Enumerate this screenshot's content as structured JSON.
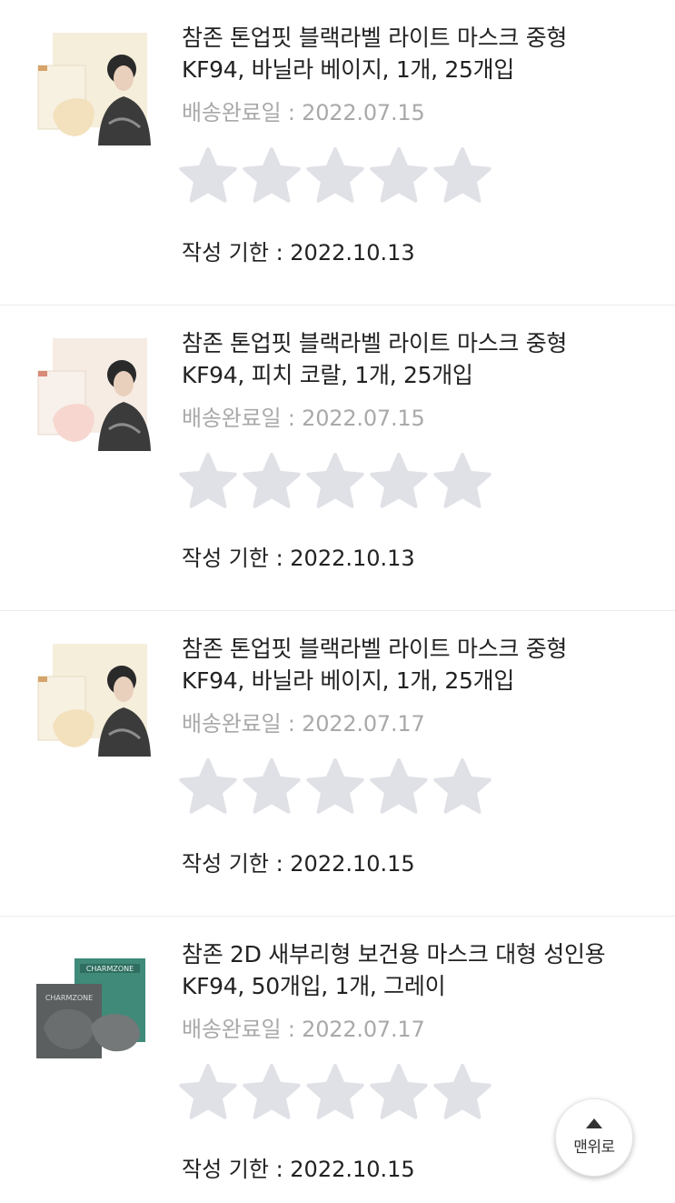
{
  "colors": {
    "star_empty": "#dfe1e6",
    "text_primary": "#222222",
    "text_muted": "#a9a9a9",
    "divider": "#ececec"
  },
  "reviews": [
    {
      "title_line1": "참존 톤업핏 블랙라벨 라이트 마스크 중형",
      "title_line2": "KF94, 바닐라 베이지, 1개, 25개입",
      "delivery": "배송완료일 : 2022.07.15",
      "deadline": "작성 기한 : 2022.10.13",
      "thumb_icon": "mask-box-vanilla-image",
      "mask_color": "#f3e1bd",
      "rating": 0
    },
    {
      "title_line1": "참존 톤업핏 블랙라벨 라이트 마스크 중형",
      "title_line2": "KF94, 피치 코랄, 1개, 25개입",
      "delivery": "배송완료일 : 2022.07.15",
      "deadline": "작성 기한 : 2022.10.13",
      "thumb_icon": "mask-box-peach-image",
      "mask_color": "#f6d6cf",
      "rating": 0
    },
    {
      "title_line1": "참존 톤업핏 블랙라벨 라이트 마스크 중형",
      "title_line2": "KF94, 바닐라 베이지, 1개, 25개입",
      "delivery": "배송완료일 : 2022.07.17",
      "deadline": "작성 기한 : 2022.10.15",
      "thumb_icon": "mask-box-vanilla-image",
      "mask_color": "#f3e1bd",
      "rating": 0
    },
    {
      "title_line1": "참존 2D 새부리형 보건용 마스크 대형 성인용",
      "title_line2": "KF94, 50개입, 1개, 그레이",
      "delivery": "배송완료일 : 2022.07.17",
      "deadline": "작성 기한 : 2022.10.15",
      "thumb_icon": "charmzone-gray-mask-image",
      "brand_text": "CHARMZONE",
      "mask_color": "#6b6e6e",
      "rating": 0
    }
  ],
  "top_button": {
    "label": "맨위로",
    "icon": "arrow-up-icon"
  }
}
